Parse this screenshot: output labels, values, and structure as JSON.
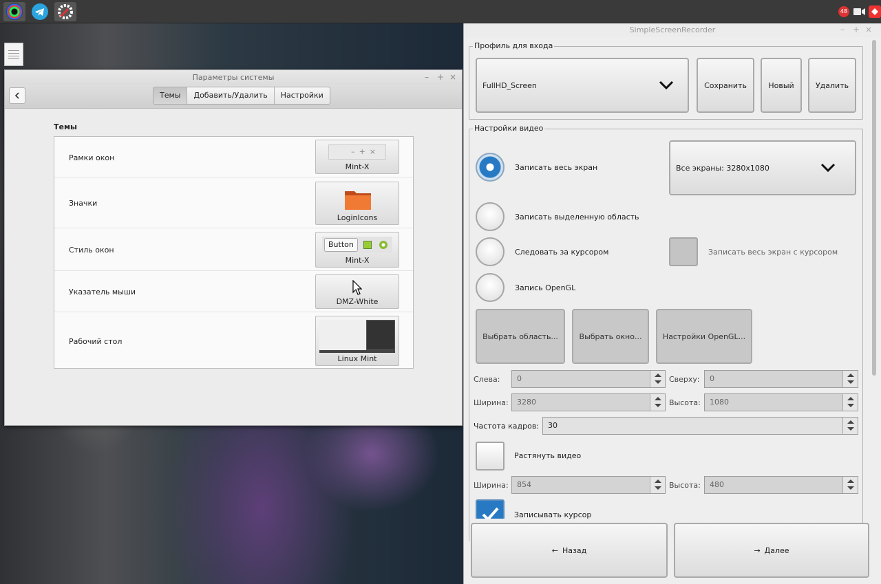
{
  "taskbar": {
    "apps": [
      {
        "icon": "camera-lens-icon"
      },
      {
        "icon": "telegram-icon"
      },
      {
        "icon": "settings-tools-icon"
      }
    ],
    "tray": {
      "notification_badge": "48",
      "icons": [
        "notification-icon",
        "video-camera-icon",
        "red-app-icon"
      ]
    }
  },
  "settings_window": {
    "title": "Параметры системы",
    "tabs": [
      {
        "label": "Темы",
        "selected": true
      },
      {
        "label": "Добавить/Удалить",
        "selected": false
      },
      {
        "label": "Настройки",
        "selected": false
      }
    ],
    "section_title": "Темы",
    "rows": [
      {
        "label": "Рамки окон",
        "value": "Mint-X"
      },
      {
        "label": "Значки",
        "value": "LoginIcons"
      },
      {
        "label": "Стиль окон",
        "value": "Mint-X",
        "preview_button": "Button"
      },
      {
        "label": "Указатель мыши",
        "value": "DMZ-White"
      },
      {
        "label": "Рабочий стол",
        "value": "Linux Mint"
      }
    ]
  },
  "ssr": {
    "title": "SimpleScreenRecorder",
    "profile_group": "Профиль для входа",
    "profile_value": "FullHD_Screen",
    "save": "Сохранить",
    "new": "Новый",
    "delete": "Удалить",
    "video_group": "Настройки видео",
    "record_full": "Записать весь экран",
    "screens_value": "Все экраны: 3280x1080",
    "record_area": "Записать выделенную область",
    "follow_cursor": "Следовать за курсором",
    "full_with_cursor": "Записать весь экран с курсором",
    "opengl": "Запись OpenGL",
    "select_area": "Выбрать область...",
    "select_window": "Выбрать окно...",
    "opengl_settings": "Настройки OpenGL...",
    "left_label": "Слева:",
    "left_value": "0",
    "top_label": "Сверху:",
    "top_value": "0",
    "width_label": "Ширина:",
    "width_value": "3280",
    "height_label": "Высота:",
    "height_value": "1080",
    "fps_label": "Частота кадров:",
    "fps_value": "30",
    "stretch": "Растянуть видео",
    "scaled_width_label": "Ширина:",
    "scaled_width_value": "854",
    "scaled_height_label": "Высота:",
    "scaled_height_value": "480",
    "record_cursor": "Записывать курсор",
    "back": "Назад",
    "next": "Далее"
  }
}
